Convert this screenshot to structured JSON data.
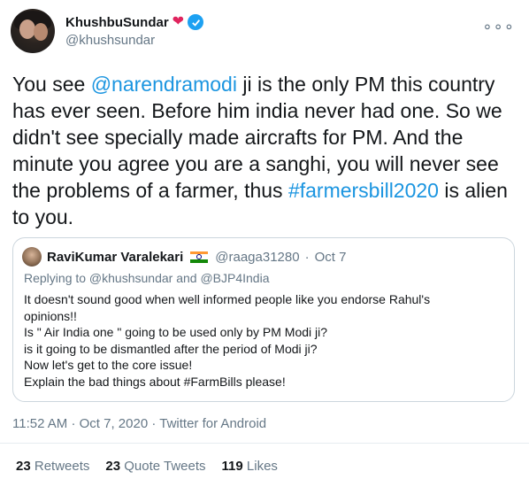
{
  "author": {
    "name": "KhushbuSundar",
    "handle": "@khushsundar"
  },
  "tweet": {
    "segments": [
      {
        "text": "You see ",
        "link": false
      },
      {
        "text": "@narendramodi",
        "link": true
      },
      {
        "text": " ji is the only PM this country has ever seen. Before him india never had one. So we didn't see specially made aircrafts for PM. And the minute you agree you are a sanghi, you will never see the problems of a farmer, thus ",
        "link": false
      },
      {
        "text": "#farmersbill2020",
        "link": true
      },
      {
        "text": " is alien to you.",
        "link": false
      }
    ]
  },
  "quote": {
    "name": "RaviKumar Varalekari",
    "handle": "@raaga31280",
    "separator": "·",
    "date": "Oct 7",
    "reply_to": "Replying to @khushsundar and @BJP4India",
    "lines": [
      "It doesn't sound good when well informed people like you endorse Rahul's",
      "opinions!!",
      "Is \" Air India one \" going to be used only by PM Modi ji?",
      "is it going to be dismantled after the period of Modi ji?",
      "Now let's get to the core issue!",
      "Explain the bad things about #FarmBills please!"
    ]
  },
  "meta": {
    "time": "11:52 AM",
    "date": "Oct 7, 2020",
    "source": "Twitter for Android",
    "separator": "·"
  },
  "stats": {
    "retweets_count": "23",
    "retweets_label": "Retweets",
    "quotes_count": "23",
    "quotes_label": "Quote Tweets",
    "likes_count": "119",
    "likes_label": "Likes"
  },
  "colors": {
    "link": "#1b95e0",
    "verified": "#1da1f2",
    "heart": "#e0245e",
    "muted": "#657786"
  },
  "icons": [
    "heart-icon",
    "verified-badge-icon",
    "more-options-icon",
    "india-flag-icon"
  ]
}
